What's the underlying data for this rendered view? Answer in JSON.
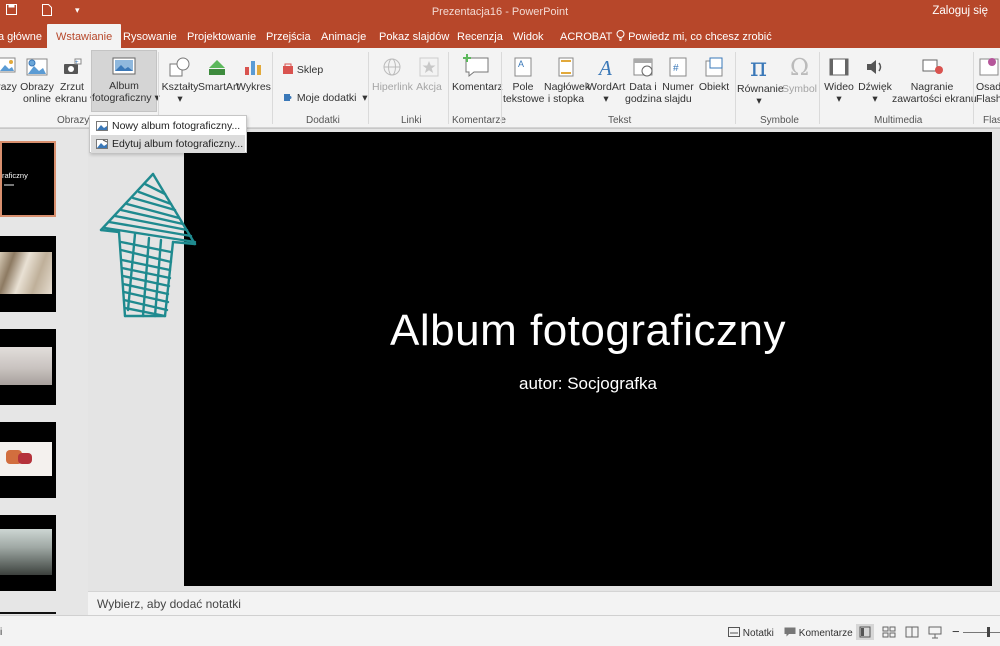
{
  "window": {
    "title": "Prezentacja16 - PowerPoint",
    "signin": "Zaloguj się"
  },
  "tabs": [
    {
      "label": "a główne"
    },
    {
      "label": "Wstawianie",
      "active": true
    },
    {
      "label": "Rysowanie"
    },
    {
      "label": "Projektowanie"
    },
    {
      "label": "Przejścia"
    },
    {
      "label": "Animacje"
    },
    {
      "label": "Pokaz slajdów"
    },
    {
      "label": "Recenzja"
    },
    {
      "label": "Widok"
    },
    {
      "label": "ACROBAT"
    }
  ],
  "tell_me": "Powiedz mi, co chcesz zrobić",
  "ribbon": {
    "obrazy_cut": "razy",
    "obrazy_online": [
      "Obrazy",
      "online"
    ],
    "zrzut_ekranu": [
      "Zrzut",
      "ekranu"
    ],
    "album": [
      "Album",
      "fotograficzny"
    ],
    "ksztalty": "Kształty",
    "smartart": "SmartArt",
    "wykres": "Wykres",
    "sklep": "Sklep",
    "moje_dodatki": "Moje dodatki",
    "hiperlink": "Hiperlink",
    "akcja": "Akcja",
    "komentarz": "Komentarz",
    "pole_tekstowe": [
      "Pole",
      "tekstowe"
    ],
    "naglowek": [
      "Nagłówek",
      "i stopka"
    ],
    "wordart": "WordArt",
    "data_godzina": [
      "Data i",
      "godzina"
    ],
    "numer_slajdu": [
      "Numer",
      "slajdu"
    ],
    "obiekt": "Obiekt",
    "rownanie": "Równanie",
    "symbol": "Symbol",
    "wideo": "Wideo",
    "dzwiek": "Dźwięk",
    "nagranie": [
      "Nagranie",
      "zawartości ekranu"
    ],
    "flash": [
      "Osad",
      "Flash"
    ],
    "groups": {
      "obrazy": "Obrazy",
      "dodatki": "Dodatki",
      "linki": "Linki",
      "komentarze": "Komentarze",
      "tekst": "Tekst",
      "symbole": "Symbole",
      "multimedia": "Multimedia",
      "flash": "Flash"
    }
  },
  "dropdown": {
    "items": [
      "Nowy album fotograficzny...",
      "Edytuj album fotograficzny..."
    ]
  },
  "thumbnails": {
    "first_slide_text": "raficzny"
  },
  "slide": {
    "title": "Album fotograficzny",
    "subtitle": "autor: Socjografka"
  },
  "notes": {
    "placeholder": "Wybierz, aby dodać notatki"
  },
  "statusbar": {
    "left_cut": "i",
    "notes": "Notatki",
    "comments": "Komentarze"
  },
  "colors": {
    "accent": "#b7472a",
    "arrow": "#1f8a8f",
    "slide_bg": "#000000"
  }
}
